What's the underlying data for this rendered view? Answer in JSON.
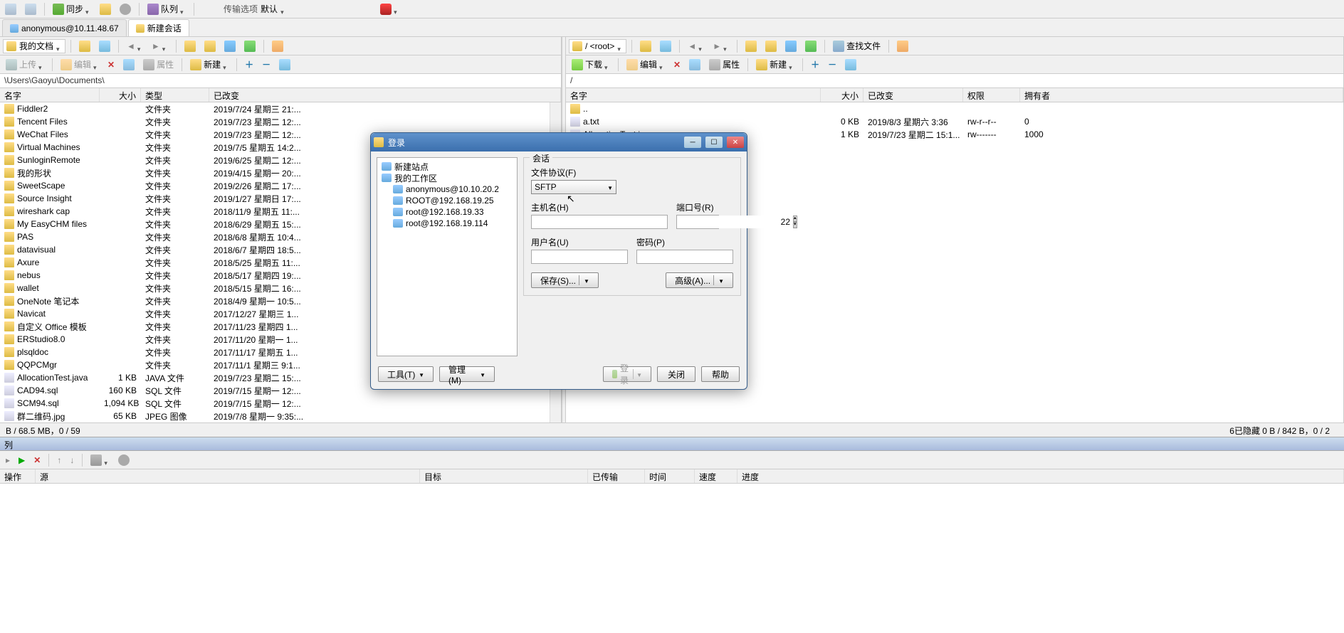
{
  "toolbar1": {
    "sync": "同步",
    "queue": "队列",
    "transferOpts": "传输选项",
    "default": "默认"
  },
  "tabs": {
    "t1": "anonymous@10.11.48.67",
    "t2": "新建会话"
  },
  "leftNav": {
    "drop": "我的文档",
    "upload": "上传",
    "edit": "编辑",
    "props": "属性",
    "new": "新建",
    "path": "\\Users\\Gaoyu\\Documents\\"
  },
  "leftHeaders": {
    "name": "名字",
    "size": "大小",
    "type": "类型",
    "modified": "已改变"
  },
  "leftFiles": [
    {
      "n": "Fiddler2",
      "s": "",
      "t": "文件夹",
      "m": "2019/7/24 星期三  21:...",
      "ic": "folder"
    },
    {
      "n": "Tencent Files",
      "s": "",
      "t": "文件夹",
      "m": "2019/7/23 星期二  12:...",
      "ic": "folder"
    },
    {
      "n": "WeChat Files",
      "s": "",
      "t": "文件夹",
      "m": "2019/7/23 星期二  12:...",
      "ic": "folder"
    },
    {
      "n": "Virtual Machines",
      "s": "",
      "t": "文件夹",
      "m": "2019/7/5 星期五  14:2...",
      "ic": "folder"
    },
    {
      "n": "SunloginRemote",
      "s": "",
      "t": "文件夹",
      "m": "2019/6/25 星期二  12:...",
      "ic": "folder"
    },
    {
      "n": "我的形状",
      "s": "",
      "t": "文件夹",
      "m": "2019/4/15 星期一  20:...",
      "ic": "folder"
    },
    {
      "n": "SweetScape",
      "s": "",
      "t": "文件夹",
      "m": "2019/2/26 星期二  17:...",
      "ic": "folder"
    },
    {
      "n": "Source Insight",
      "s": "",
      "t": "文件夹",
      "m": "2019/1/27 星期日  17:...",
      "ic": "folder"
    },
    {
      "n": "wireshark cap",
      "s": "",
      "t": "文件夹",
      "m": "2018/11/9 星期五  11:...",
      "ic": "folder"
    },
    {
      "n": "My EasyCHM files",
      "s": "",
      "t": "文件夹",
      "m": "2018/6/29 星期五  15:...",
      "ic": "folder"
    },
    {
      "n": "PAS",
      "s": "",
      "t": "文件夹",
      "m": "2018/6/8 星期五  10:4...",
      "ic": "folder"
    },
    {
      "n": "datavisual",
      "s": "",
      "t": "文件夹",
      "m": "2018/6/7 星期四  18:5...",
      "ic": "folder"
    },
    {
      "n": "Axure",
      "s": "",
      "t": "文件夹",
      "m": "2018/5/25 星期五  11:...",
      "ic": "folder"
    },
    {
      "n": "nebus",
      "s": "",
      "t": "文件夹",
      "m": "2018/5/17 星期四  19:...",
      "ic": "folder"
    },
    {
      "n": "wallet",
      "s": "",
      "t": "文件夹",
      "m": "2018/5/15 星期二  16:...",
      "ic": "folder"
    },
    {
      "n": "OneNote 笔记本",
      "s": "",
      "t": "文件夹",
      "m": "2018/4/9 星期一  10:5...",
      "ic": "folder"
    },
    {
      "n": "Navicat",
      "s": "",
      "t": "文件夹",
      "m": "2017/12/27 星期三  1...",
      "ic": "folder"
    },
    {
      "n": "自定义 Office 模板",
      "s": "",
      "t": "文件夹",
      "m": "2017/11/23 星期四  1...",
      "ic": "folder"
    },
    {
      "n": "ERStudio8.0",
      "s": "",
      "t": "文件夹",
      "m": "2017/11/20 星期一  1...",
      "ic": "folder"
    },
    {
      "n": "plsqldoc",
      "s": "",
      "t": "文件夹",
      "m": "2017/11/17 星期五  1...",
      "ic": "folder"
    },
    {
      "n": "QQPCMgr",
      "s": "",
      "t": "文件夹",
      "m": "2017/11/1 星期三  9:1...",
      "ic": "folder"
    },
    {
      "n": "AllocationTest.java",
      "s": "1 KB",
      "t": "JAVA 文件",
      "m": "2019/7/23 星期二  15:...",
      "ic": "file"
    },
    {
      "n": "CAD94.sql",
      "s": "160 KB",
      "t": "SQL 文件",
      "m": "2019/7/15 星期一  12:...",
      "ic": "file"
    },
    {
      "n": "SCM94.sql",
      "s": "1,094 KB",
      "t": "SQL 文件",
      "m": "2019/7/15 星期一  12:...",
      "ic": "file"
    },
    {
      "n": "群二维码.jpg",
      "s": "65 KB",
      "t": "JPEG 图像",
      "m": "2019/7/8 星期一  9:35:...",
      "ic": "file"
    }
  ],
  "leftStatus": "B / 68.5 MB，0 / 59",
  "rightNav": {
    "drop": "/ <root>",
    "find": "查找文件",
    "download": "下载",
    "edit": "编辑",
    "props": "属性",
    "new": "新建",
    "path": "/"
  },
  "rightHeaders": {
    "name": "名字",
    "size": "大小",
    "modified": "已改变",
    "perms": "权限",
    "owner": "拥有者"
  },
  "rightFiles": [
    {
      "n": "..",
      "s": "",
      "m": "",
      "p": "",
      "o": "",
      "ic": "folder"
    },
    {
      "n": "a.txt",
      "s": "0 KB",
      "m": "2019/8/3 星期六 3:36",
      "p": "rw-r--r--",
      "o": "0",
      "ic": "file"
    },
    {
      "n": "AllocationTest.java",
      "s": "1 KB",
      "m": "2019/7/23 星期二 15:1...",
      "p": "rw-------",
      "o": "1000",
      "ic": "file"
    }
  ],
  "rightStatus": "6已隐藏   0 B / 842 B，0 / 2",
  "queue": {
    "header": "列",
    "cols": {
      "op": "操作",
      "src": "源",
      "dst": "目标",
      "trans": "已传输",
      "time": "时间",
      "speed": "速度",
      "prog": "进度"
    }
  },
  "dialog": {
    "title": "登录",
    "tree": {
      "newsite": "新建站点",
      "workspace": "我的工作区",
      "items": [
        "anonymous@10.10.20.2",
        "ROOT@192.168.19.25",
        "root@192.168.19.33",
        "root@192.168.19.114"
      ]
    },
    "session": "会话",
    "protocolLbl": "文件协议(F)",
    "protocol": "SFTP",
    "hostLbl": "主机名(H)",
    "portLbl": "端口号(R)",
    "port": "22",
    "userLbl": "用户名(U)",
    "passLbl": "密码(P)",
    "save": "保存(S)...",
    "advanced": "高级(A)...",
    "tools": "工具(T)",
    "manage": "管理(M)",
    "login": "登录",
    "close": "关闭",
    "help": "帮助"
  }
}
